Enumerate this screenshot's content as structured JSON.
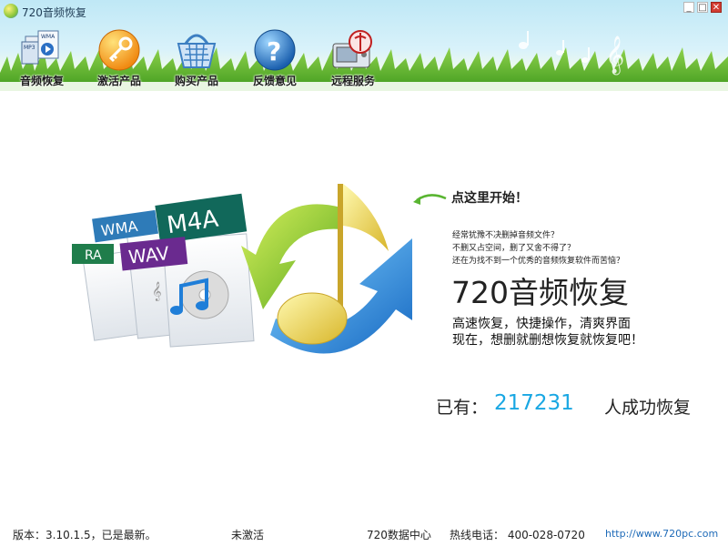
{
  "window": {
    "title": "720音频恢复",
    "controls": {
      "minimize": "_",
      "maximize": "□",
      "close": "✕"
    }
  },
  "toolbar": {
    "items": [
      {
        "label": "音频恢复",
        "icon": "audio-files-icon"
      },
      {
        "label": "激活产品",
        "icon": "key-icon"
      },
      {
        "label": "购买产品",
        "icon": "shopping-basket-icon"
      },
      {
        "label": "反馈意见",
        "icon": "help-question-icon"
      },
      {
        "label": "远程服务",
        "icon": "remote-service-icon"
      }
    ]
  },
  "main": {
    "art_formats": [
      "WMA",
      "M4A",
      "RA",
      "WAV"
    ],
    "start_link": "点这里开始！",
    "questions": [
      "经常犹豫不决删掉音频文件？",
      "不删又占空间，删了又舍不得了？",
      "还在为找不到一个优秀的音频恢复软件而苦恼？"
    ],
    "brand_title": "720音频恢复",
    "taglines": [
      "高速恢复，快捷操作，清爽界面",
      "现在，想删就删想恢复就恢复吧！"
    ],
    "counter": {
      "prefix": "已有：",
      "value": "217231",
      "suffix": "人成功恢复"
    }
  },
  "statusbar": {
    "version": "版本：3.10.1.5，已是最新。",
    "activation": "未激活",
    "data_center": "720数据中心",
    "hotline": "热线电话： 400-028-0720",
    "website": "http://www.720pc.com"
  },
  "colors": {
    "counter_value": "#19a7e3",
    "header_sky": "#bfe8f6",
    "grass": "#5fb52a",
    "link": "#1f6bb8"
  }
}
